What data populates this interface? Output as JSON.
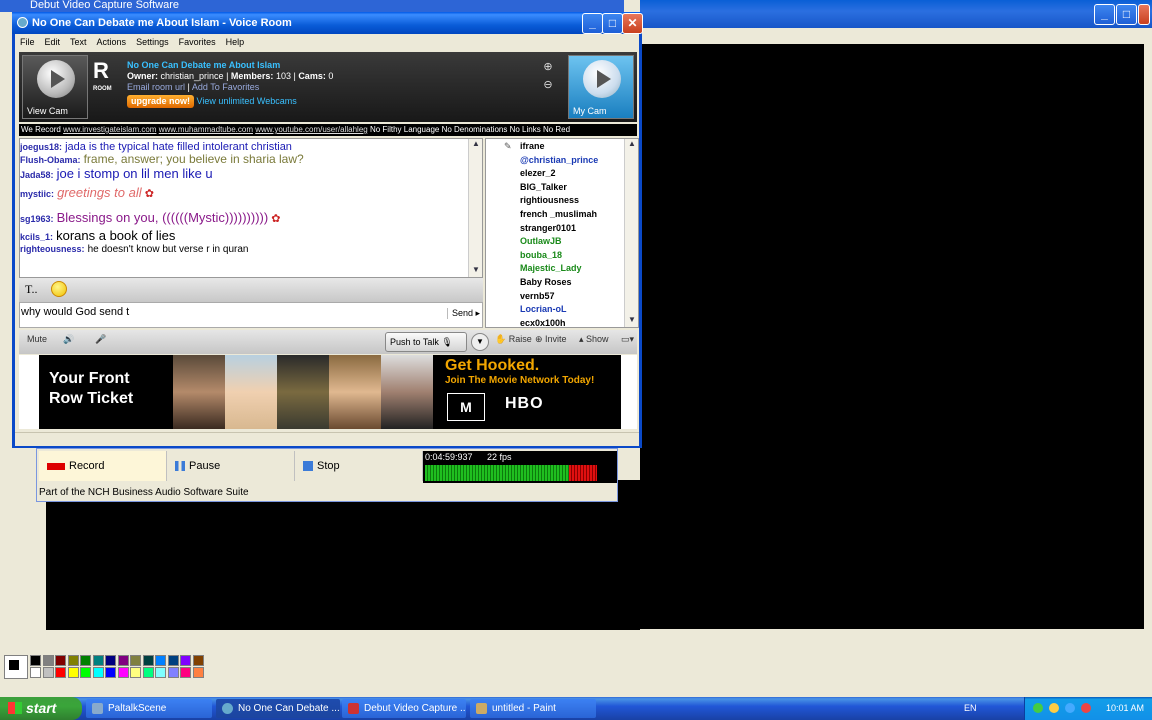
{
  "debut": {
    "title": "Debut Video Capture Software",
    "buttons": {
      "record": "Record",
      "pause": "Pause",
      "stop": "Stop"
    },
    "timer": "0:04:59:937",
    "fps": "22 fps",
    "level": 0.82,
    "status": "Part of the NCH Business Audio Software Suite"
  },
  "paltalk": {
    "title": "No One Can Debate me About Islam - Voice Room",
    "menu": [
      "File",
      "Edit",
      "Text",
      "Actions",
      "Settings",
      "Favorites",
      "Help"
    ],
    "room": {
      "view_cam": "View Cam",
      "my_cam": "My Cam",
      "logo": "R",
      "logo_sub": "ROOM",
      "name": "No One Can Debate me About Islam",
      "owner_label": "Owner:",
      "owner": "christian_prince",
      "members_label": "Members:",
      "members": "103",
      "cams_label": "Cams:",
      "cams": "0",
      "email_link": "Email room url",
      "fav_link": "Add To Favorites",
      "upgrade": "upgrade now!",
      "webcams": "View unlimited Webcams",
      "zoom_in": "⊕",
      "zoom_out": "⊖"
    },
    "ticker": {
      "prefix": "We Record",
      "links": [
        "www.investigateislam.com",
        "www.muhammadtube.com",
        "www.youtube.com/user/allahleg"
      ],
      "suffix": "No Filthy Language No Denominations No Links No Red"
    },
    "chat": [
      {
        "nick": "joegus18:",
        "text": "jada is the typical hate filled intolerant christian",
        "color": "#1a1ab4",
        "size": 11
      },
      {
        "nick": "Flush-Obama:",
        "text": "frame, answer; you believe in sharia law?",
        "color": "#7a7a3a",
        "size": 12
      },
      {
        "nick": "Jada58:",
        "text": "joe i stomp on lil men like u",
        "color": "#1a1ab4",
        "size": 13
      },
      {
        "nick": "mystiic:",
        "text": "greetings to all",
        "color": "#e06a6a",
        "size": 13,
        "italic": true,
        "rose": true
      },
      {
        "nick": "sg1963:",
        "text": "Blessings on you, ((((((Mystic))))))))))",
        "color": "#8a1a8a",
        "size": 13,
        "rose": true
      },
      {
        "nick": "kcils_1:",
        "text": "korans a book of lies",
        "color": "#000000",
        "size": 13
      },
      {
        "nick": "righteousness:",
        "text": "he doesn't know but verse r in quran",
        "color": "#000000",
        "size": 10
      }
    ],
    "users": [
      {
        "name": "ifrane",
        "color": "#000000"
      },
      {
        "name": "@christian_prince",
        "color": "#1a3ab4"
      },
      {
        "name": "elezer_2",
        "color": "#000000"
      },
      {
        "name": "BIG_Talker",
        "color": "#000000"
      },
      {
        "name": "rightiousness",
        "color": "#000000"
      },
      {
        "name": "french _muslimah",
        "color": "#000000"
      },
      {
        "name": "stranger0101",
        "color": "#000000"
      },
      {
        "name": "OutlawJB",
        "color": "#1a8a1a"
      },
      {
        "name": "bouba_18",
        "color": "#1a8a1a"
      },
      {
        "name": "Majestic_Lady",
        "color": "#1a8a1a"
      },
      {
        "name": "Baby Roses",
        "color": "#000000"
      },
      {
        "name": "vernb57",
        "color": "#000000"
      },
      {
        "name": "Locrian-oL",
        "color": "#1a3ab4"
      },
      {
        "name": "ecx0x100h",
        "color": "#000000"
      }
    ],
    "format_text": "T..",
    "input_value": "why would God send t",
    "send": "Send ▸",
    "controls": {
      "mute": "Mute",
      "push_to_talk": "Push to Talk",
      "raise": "Raise",
      "invite": "Invite",
      "show": "Show"
    },
    "ad": {
      "front": "Your Front Row Ticket",
      "hook": "Get Hooked.",
      "join": "Join The Movie Network Today!",
      "tmn": "M",
      "hbo": "HBO"
    }
  },
  "taskbar": {
    "start": "start",
    "tasks": [
      {
        "label": "PaltalkScene",
        "active": false
      },
      {
        "label": "No One Can Debate ...",
        "active": true
      },
      {
        "label": "Debut Video Capture ...",
        "active": false
      },
      {
        "label": "untitled - Paint",
        "active": false
      }
    ],
    "lang": "EN",
    "clock": "10:01 AM"
  },
  "palette": [
    "#000000",
    "#808080",
    "#800000",
    "#808000",
    "#008000",
    "#008080",
    "#000080",
    "#800080",
    "#808040",
    "#004040",
    "#0080ff",
    "#004080",
    "#8000ff",
    "#804000",
    "#ffffff",
    "#c0c0c0",
    "#ff0000",
    "#ffff00",
    "#00ff00",
    "#00ffff",
    "#0000ff",
    "#ff00ff",
    "#ffff80",
    "#00ff80",
    "#80ffff",
    "#8080ff",
    "#ff0080",
    "#ff8040"
  ]
}
